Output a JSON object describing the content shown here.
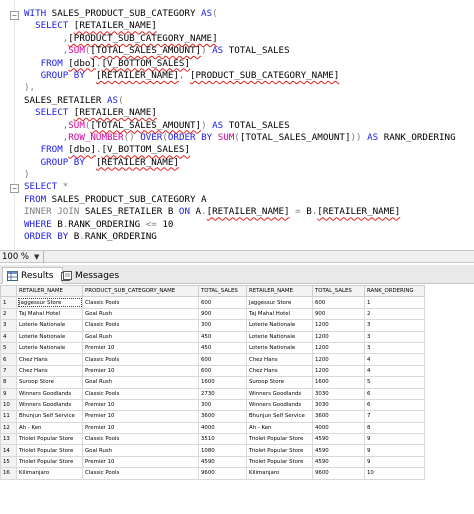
{
  "editor": {
    "lines": [
      [
        [
          "kw",
          "WITH "
        ],
        [
          "",
          "SALES_PRODUCT_SUB_CATEGORY "
        ],
        [
          "kw",
          "AS"
        ],
        [
          "gr",
          "("
        ]
      ],
      [
        [
          "kw",
          "  SELECT "
        ],
        [
          "sq",
          "[RETAILER_NAME]"
        ]
      ],
      [
        [
          "gr",
          "       ,"
        ],
        [
          "sq",
          "[PRODUCT_SUB_CATEGORY_NAME]"
        ]
      ],
      [
        [
          "gr",
          "       ,"
        ],
        [
          "fn",
          "SUM"
        ],
        [
          "gr",
          "("
        ],
        [
          "sq",
          "[TOTAL_SALES_AMOUNT]"
        ],
        [
          "gr",
          ") "
        ],
        [
          "kw",
          "AS "
        ],
        [
          "",
          "TOTAL_SALES"
        ]
      ],
      [
        [
          "kw",
          "   FROM "
        ],
        [
          "sq",
          "[dbo]"
        ],
        [
          "gr",
          "."
        ],
        [
          "sq",
          "[V_BOTTOM_SALES]"
        ]
      ],
      [
        [
          "kw",
          "   GROUP BY  "
        ],
        [
          "sq",
          "[RETAILER_NAME]"
        ],
        [
          "gr",
          ", "
        ],
        [
          "sq",
          "[PRODUCT_SUB_CATEGORY_NAME]"
        ]
      ],
      [
        [
          "gr",
          "),"
        ]
      ],
      [
        [
          "",
          "SALES_RETAILER "
        ],
        [
          "kw",
          "AS"
        ],
        [
          "gr",
          "("
        ]
      ],
      [
        [
          "kw",
          "  SELECT "
        ],
        [
          "sq",
          "[RETAILER_NAME]"
        ]
      ],
      [
        [
          "gr",
          "       ,"
        ],
        [
          "fn",
          "SUM"
        ],
        [
          "gr",
          "("
        ],
        [
          "sq",
          "[TOTAL_SALES_AMOUNT]"
        ],
        [
          "gr",
          ") "
        ],
        [
          "kw",
          "AS "
        ],
        [
          "",
          "TOTAL_SALES"
        ]
      ],
      [
        [
          "gr",
          "       ,"
        ],
        [
          "fn",
          "ROW_NUMBER"
        ],
        [
          "gr",
          "() "
        ],
        [
          "kw",
          "OVER"
        ],
        [
          "gr",
          "("
        ],
        [
          "kw",
          "ORDER BY "
        ],
        [
          "fn",
          "SUM"
        ],
        [
          "gr",
          "("
        ],
        [
          "",
          "[TOTAL_SALES_AMOUNT]"
        ],
        [
          "gr",
          "))"
        ],
        [
          "kw",
          " AS "
        ],
        [
          "",
          "RANK_ORDERING"
        ]
      ],
      [
        [
          "kw",
          "   FROM "
        ],
        [
          "sq",
          "[dbo]"
        ],
        [
          "gr",
          "."
        ],
        [
          "sq",
          "[V_BOTTOM_SALES]"
        ]
      ],
      [
        [
          "kw",
          "   GROUP BY  "
        ],
        [
          "sq",
          "[RETAILER_NAME]"
        ]
      ],
      [
        [
          "gr",
          ")"
        ]
      ],
      [
        [
          "kw",
          "SELECT "
        ],
        [
          "gr",
          "*"
        ]
      ],
      [
        [
          "kw",
          "FROM "
        ],
        [
          "",
          "SALES_PRODUCT_SUB_CATEGORY A"
        ]
      ],
      [
        [
          "gr",
          "INNER JOIN "
        ],
        [
          "",
          "SALES_RETAILER B "
        ],
        [
          "kw",
          "ON "
        ],
        [
          "",
          "A"
        ],
        [
          "gr",
          "."
        ],
        [
          "sq",
          "[RETAILER_NAME]"
        ],
        [
          "gr",
          " = "
        ],
        [
          "",
          "B"
        ],
        [
          "gr",
          "."
        ],
        [
          "sq",
          "[RETAILER_NAME]"
        ]
      ],
      [
        [
          "kw",
          "WHERE "
        ],
        [
          "",
          "B"
        ],
        [
          "gr",
          "."
        ],
        [
          "",
          "RANK_ORDERING "
        ],
        [
          "gr",
          "<= "
        ],
        [
          "",
          "10"
        ]
      ],
      [
        [
          "kw",
          "ORDER BY "
        ],
        [
          "",
          "B"
        ],
        [
          "gr",
          "."
        ],
        [
          "",
          "RANK_ORDERING"
        ]
      ]
    ]
  },
  "zoom": {
    "value": "100 %"
  },
  "tabs": {
    "results": "Results",
    "messages": "Messages"
  },
  "colors": {
    "keyword": "#1f20e6",
    "function": "#d0009a",
    "operator": "#7d7d7d",
    "squiggle": "#e02020"
  },
  "grid": {
    "columns": [
      "RETAILER_NAME",
      "PRODUCT_SUB_CATEGORY_NAME",
      "TOTAL_SALES",
      "RETAILER_NAME",
      "TOTAL_SALES",
      "RANK_ORDERING"
    ],
    "rows": [
      [
        "1",
        "Jaggessur Store",
        "Classic Pools",
        "600",
        "Jaggessur Store",
        "600",
        "1"
      ],
      [
        "2",
        "Taj Mahal Hotel",
        "Goal Rush",
        "900",
        "Taj Mahal Hotel",
        "900",
        "2"
      ],
      [
        "3",
        "Loterie Nationale",
        "Classic Pools",
        "300",
        "Loterie Nationale",
        "1200",
        "3"
      ],
      [
        "4",
        "Loterie Nationale",
        "Goal Rush",
        "450",
        "Loterie Nationale",
        "1200",
        "3"
      ],
      [
        "5",
        "Loterie Nationale",
        "Premier 10",
        "450",
        "Loterie Nationale",
        "1200",
        "3"
      ],
      [
        "6",
        "Chez Hans",
        "Classic Pools",
        "600",
        "Chez Hans",
        "1200",
        "4"
      ],
      [
        "7",
        "Chez Hans",
        "Premier 10",
        "600",
        "Chez Hans",
        "1200",
        "4"
      ],
      [
        "8",
        "Suroop Store",
        "Goal Rush",
        "1600",
        "Suroop Store",
        "1600",
        "5"
      ],
      [
        "9",
        "Winners Goodlands",
        "Classic Pools",
        "2730",
        "Winners Goodlands",
        "3030",
        "6"
      ],
      [
        "10",
        "Winners Goodlands",
        "Premier 10",
        "300",
        "Winners Goodlands",
        "3030",
        "6"
      ],
      [
        "11",
        "Bhunjun Self Service",
        "Premier 10",
        "3600",
        "Bhunjun Self Service",
        "3600",
        "7"
      ],
      [
        "12",
        "Ah - Ken",
        "Premier 10",
        "4000",
        "Ah - Ken",
        "4000",
        "8"
      ],
      [
        "13",
        "Triolet Popular Store",
        "Classic Pools",
        "3510",
        "Triolet Popular Store",
        "4590",
        "9"
      ],
      [
        "14",
        "Triolet Popular Store",
        "Goal Rush",
        "1080",
        "Triolet Popular Store",
        "4590",
        "9"
      ],
      [
        "15",
        "Triolet Popular Store",
        "Premier 10",
        "4590",
        "Triolet Popular Store",
        "4590",
        "9"
      ],
      [
        "16",
        "Kilimanjaro",
        "Classic Pools",
        "9600",
        "Kilimanjaro",
        "9600",
        "10"
      ]
    ]
  }
}
